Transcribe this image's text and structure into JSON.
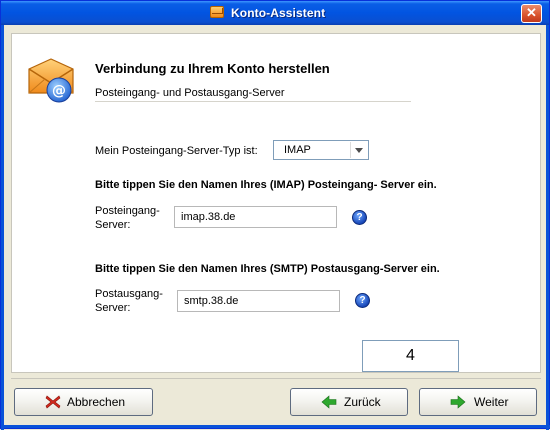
{
  "window": {
    "title": "Konto-Assistent",
    "close_symbol": "✕"
  },
  "header": {
    "title": "Verbindung zu Ihrem Konto herstellen",
    "subtitle": "Posteingang- und Postausgang-Server"
  },
  "server_type": {
    "label": "Mein Posteingang-Server-Typ ist:",
    "selected": "IMAP"
  },
  "incoming": {
    "instruction": "Bitte tippen Sie den Namen Ihres (IMAP) Posteingang- Server ein.",
    "label_line1": "Posteingang-",
    "label_line2": "Server:",
    "value": "imap.38.de"
  },
  "outgoing": {
    "instruction": "Bitte tippen Sie den Namen Ihres (SMTP) Postausgang-Server ein.",
    "label_line1": "Postausgang-",
    "label_line2": "Server:",
    "value": "smtp.38.de"
  },
  "help_symbol": "?",
  "page_number": "4",
  "buttons": {
    "cancel": "Abbrechen",
    "back": "Zurück",
    "next": "Weiter"
  },
  "colors": {
    "titlebar": "#0254e1",
    "cancel_icon": "#d42a1e",
    "arrow_green": "#2ea82e"
  }
}
